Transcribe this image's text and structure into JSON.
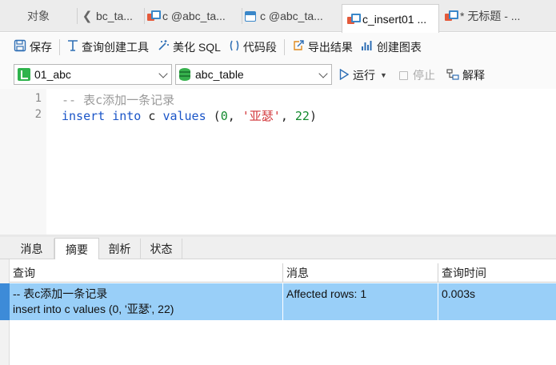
{
  "tabs": {
    "objects": "对象",
    "items": [
      {
        "label": "bc_ta..."
      },
      {
        "label": "c @abc_ta..."
      },
      {
        "label": "c @abc_ta..."
      },
      {
        "label": "c_insert01 ..."
      },
      {
        "label": "* 无标题 - ..."
      }
    ]
  },
  "toolbar": {
    "save": "保存",
    "query_builder": "查询创建工具",
    "beautify": "美化 SQL",
    "snippet": "代码段",
    "export": "导出结果",
    "create_chart": "创建图表"
  },
  "selectors": {
    "connection": "01_abc",
    "database": "abc_table"
  },
  "run": {
    "run": "运行",
    "stop": "停止",
    "explain": "解释"
  },
  "editor": {
    "line_numbers": [
      "1",
      "2"
    ],
    "line1_comment": "-- 表c添加一条记录",
    "line2": {
      "kw1": "insert",
      "kw2": "into",
      "table": "c",
      "kw3": "values",
      "open": "(",
      "n1": "0",
      "comma1": ", ",
      "str": "'亚瑟'",
      "comma2": ", ",
      "n2": "22",
      "close": ")"
    }
  },
  "result_tabs": [
    "消息",
    "摘要",
    "剖析",
    "状态"
  ],
  "result_table": {
    "headers": [
      "查询",
      "消息",
      "查询时间"
    ],
    "row": {
      "query": "-- 表c添加一条记录\ninsert into c values (0, '亚瑟', 22)",
      "message": "Affected rows: 1",
      "time": "0.003s"
    }
  },
  "colors": {
    "selected_row": "#99cff8",
    "keyword": "#1a55c8",
    "string": "#d2363a",
    "number": "#138a2e",
    "comment": "#9a9a9a"
  }
}
